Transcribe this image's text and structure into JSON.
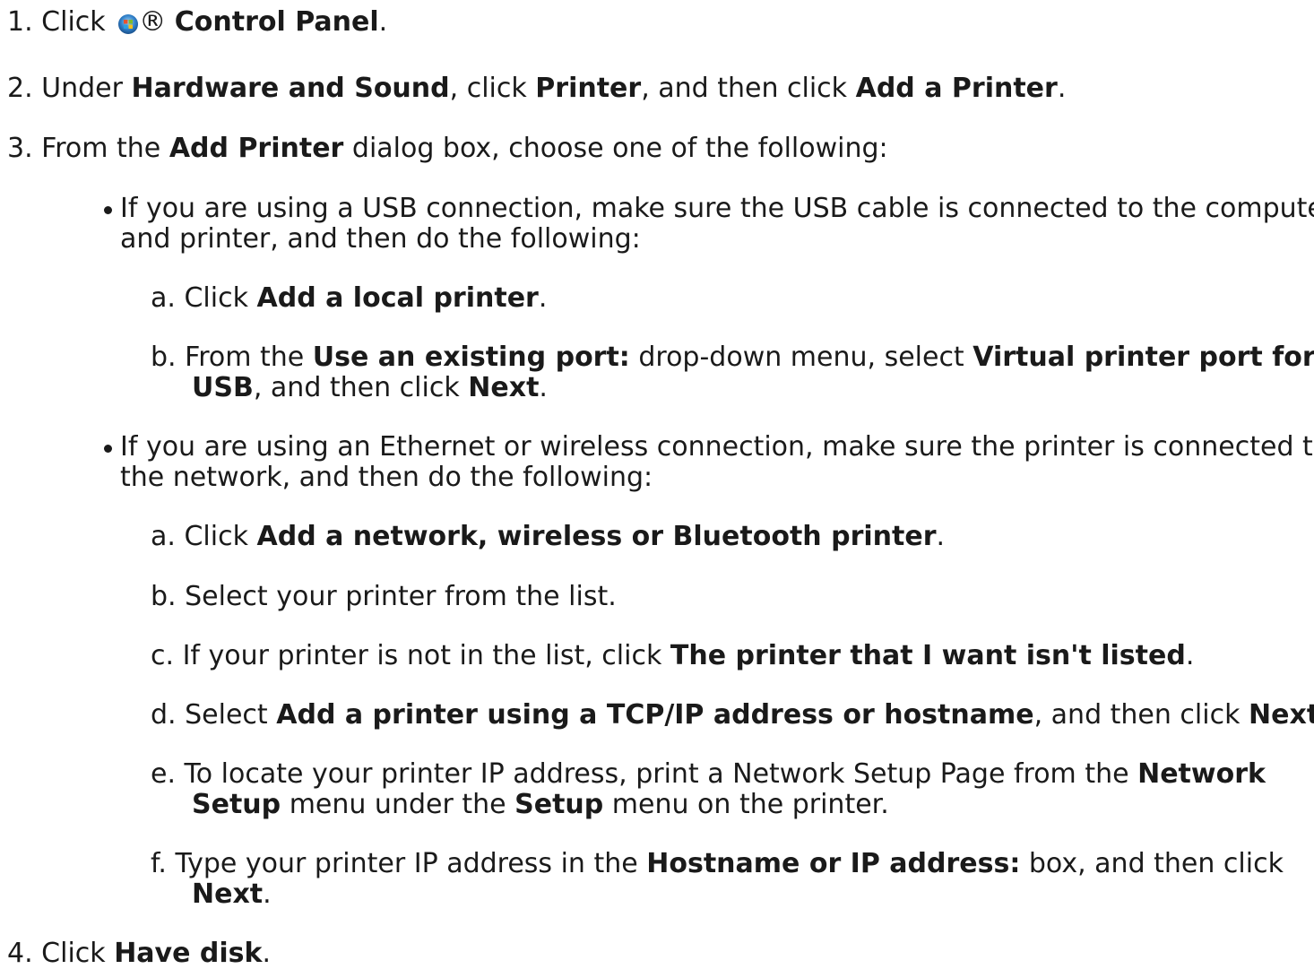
{
  "step1": {
    "number": "1.",
    "prefix": "Click",
    "icon": "windows-start-icon",
    "registered": "®",
    "bold": "Control Panel",
    "suffix": "."
  },
  "step2": {
    "number": "2.",
    "t1": "Under",
    "b1": "Hardware and Sound",
    "t2": ", click",
    "b2": "Printer",
    "t3": ", and then click",
    "b3": "Add a Printer",
    "t4": "."
  },
  "step3": {
    "number": "3.",
    "t1": "From the",
    "b1": "Add Printer",
    "t2": "dialog box, choose one of the following:"
  },
  "usb": {
    "line1": "If you are using a USB connection, make sure the USB cable is connected to the computer",
    "line2": "and printer, and then do the following:",
    "a": {
      "letter": "a.",
      "t1": "Click",
      "b1": "Add a local printer",
      "t2": "."
    },
    "b": {
      "letter": "b.",
      "t1": "From the",
      "b1": "Use an existing port:",
      "t2": "drop-down menu, select",
      "b2": "Virtual printer port for",
      "b3": "USB",
      "t3": ", and then click",
      "b4": "Next",
      "t4": "."
    }
  },
  "network": {
    "line1": "If you are using an Ethernet or wireless connection, make sure the printer is connected to",
    "line2": "the network, and then do the following:",
    "a": {
      "letter": "a.",
      "t1": "Click",
      "b1": "Add a network, wireless or Bluetooth printer",
      "t2": "."
    },
    "b": {
      "letter": "b.",
      "t1": "Select your printer from the list."
    },
    "c": {
      "letter": "c.",
      "t1": "If your printer is not in the list, click",
      "b1": "The printer that I want isn't listed",
      "t2": "."
    },
    "d": {
      "letter": "d.",
      "t1": "Select",
      "b1": "Add a printer using a TCP/IP address or hostname",
      "t2": ", and then click",
      "b2": "Next",
      "t3": "."
    },
    "e": {
      "letter": "e.",
      "t1": "To locate your printer IP address, print a Network Setup Page from the",
      "b1": "Network",
      "b2": "Setup",
      "t2": "menu under the",
      "b3": "Setup",
      "t3": "menu on the printer."
    },
    "f": {
      "letter": "f.",
      "t1": "Type your printer IP address in the",
      "b1": "Hostname or IP address:",
      "t2": "box, and then click",
      "b2": "Next",
      "t3": "."
    }
  },
  "step4": {
    "number": "4.",
    "t1": "Click",
    "b1": "Have disk",
    "t2": "."
  }
}
